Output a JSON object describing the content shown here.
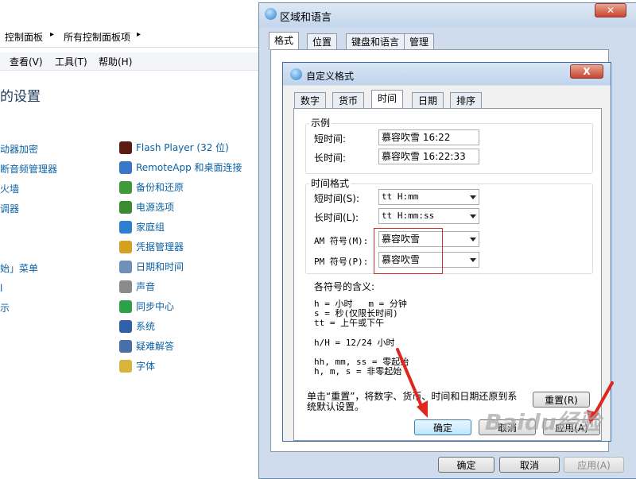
{
  "control_panel": {
    "breadcrumb": [
      "控制面板",
      "所有控制面板项"
    ],
    "menu": [
      "查看(V)",
      "工具(T)",
      "帮助(H)"
    ],
    "title": "的设置",
    "left_items": [
      "动器加密",
      "断音频管理器",
      "火墙",
      "调器",
      "",
      "",
      "始」菜单",
      "l",
      "示"
    ],
    "right_items": [
      {
        "label": "Flash Player (32 位)",
        "icon": "flash-icon",
        "color": "#5a1c12"
      },
      {
        "label": "RemoteApp 和桌面连接",
        "icon": "remoteapp-icon",
        "color": "#3a77c9"
      },
      {
        "label": "备份和还原",
        "icon": "backup-icon",
        "color": "#3f9b3a"
      },
      {
        "label": "电源选项",
        "icon": "power-icon",
        "color": "#3a8c2e"
      },
      {
        "label": "家庭组",
        "icon": "homegroup-icon",
        "color": "#2f7fd0"
      },
      {
        "label": "凭据管理器",
        "icon": "credential-icon",
        "color": "#d4a020"
      },
      {
        "label": "日期和时间",
        "icon": "datetime-icon",
        "color": "#6d8fb8"
      },
      {
        "label": "声音",
        "icon": "sound-icon",
        "color": "#8b8b8b"
      },
      {
        "label": "同步中心",
        "icon": "sync-icon",
        "color": "#2ea04a"
      },
      {
        "label": "系统",
        "icon": "system-icon",
        "color": "#3060a8"
      },
      {
        "label": "疑难解答",
        "icon": "troubleshoot-icon",
        "color": "#4a6ea8"
      },
      {
        "label": "字体",
        "icon": "font-icon",
        "color": "#d8b43a"
      }
    ]
  },
  "region_dialog": {
    "title": "区域和语言",
    "tabs": [
      "格式",
      "位置",
      "键盘和语言",
      "管理"
    ],
    "buttons": {
      "ok": "确定",
      "cancel": "取消",
      "apply": "应用(A)"
    }
  },
  "custom_format_dialog": {
    "title": "自定义格式",
    "close": "X",
    "tabs": [
      "数字",
      "货币",
      "时间",
      "日期",
      "排序"
    ],
    "example": {
      "group_label": "示例",
      "short_label": "短时间:",
      "short_value": "慕容吹雪 16:22",
      "long_label": "长时间:",
      "long_value": "慕容吹雪 16:22:33"
    },
    "time_format": {
      "group_label": "时间格式",
      "short_label": "短时间(S):",
      "short_value": "tt H:mm",
      "long_label": "长时间(L):",
      "long_value": "tt H:mm:ss",
      "am_label": "AM 符号(M):",
      "am_value": "慕容吹雪",
      "pm_label": "PM 符号(P):",
      "pm_value": "慕容吹雪"
    },
    "help": {
      "heading": "各符号的含义:",
      "line1": "h = 小时   m = 分钟",
      "line2": "s = 秒(仅限长时间)",
      "line3": "tt = 上午或下午",
      "line4": "h/H = 12/24 小时",
      "line5": "hh, mm, ss = 零起始",
      "line6": "h, m, s = 非零起始"
    },
    "reset_text_1": "单击“重置”，将数字、货币、时间和日期还原到系",
    "reset_text_2": "统默认设置。",
    "reset_button": "重置(R)",
    "buttons": {
      "ok": "确定",
      "cancel": "取消",
      "apply": "应用(A)"
    }
  },
  "watermark": "Baidu经验",
  "colors": {
    "highlight": "#d4302a",
    "arrow": "#e0261f",
    "link": "#0b61a4"
  }
}
